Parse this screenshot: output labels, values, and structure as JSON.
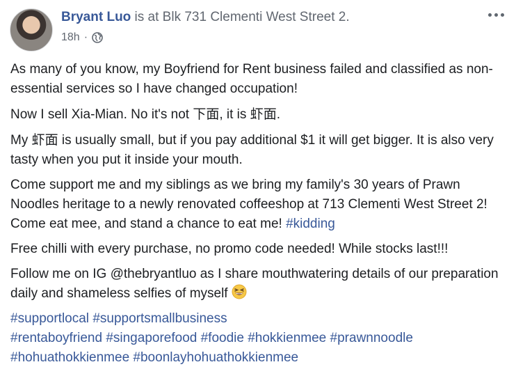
{
  "post": {
    "author": "Bryant Luo",
    "location_text": " is at Blk 731 Clementi West Street 2.",
    "time": "18h",
    "meta_separator": "·",
    "privacy_icon": "globe-icon",
    "more_icon": "more-options-icon",
    "paragraphs": {
      "p1": "As many of you know, my Boyfriend for Rent business failed and classified as non-essential services so I have changed occupation!",
      "p2_a": "Now I sell Xia-Mian. No it's not ",
      "p2_cjk1": "下面",
      "p2_b": ", it is ",
      "p2_cjk2": "虾面",
      "p2_c": ".",
      "p3_a": "My ",
      "p3_cjk": "虾面",
      "p3_b": " is usually small, but if you pay additional $1 it will get bigger. It is also very tasty when you put it inside your mouth.",
      "p4_a": "Come support me and my siblings as we bring my family's 30 years of Prawn Noodles heritage to a newly renovated coffeeshop at 713 Clementi West Street 2! Come eat mee, and stand a chance to eat me! ",
      "p4_tag": "#kidding",
      "p5": "Free chilli with every purchase, no promo code needed! While stocks last!!!",
      "p6": "Follow me on IG @thebryantluo as I share mouthwatering details of our preparation daily and shameless selfies of myself ",
      "p6_emoji": "grinning-squinting-face-icon"
    },
    "hashtags": [
      "#supportlocal",
      "#supportsmallbusiness",
      "#rentaboyfriend",
      "#singaporefood",
      "#foodie",
      "#hokkienmee",
      "#prawnnoodle",
      "#hohuathokkienmee",
      "#boonlayhohuathokkienmee"
    ]
  }
}
